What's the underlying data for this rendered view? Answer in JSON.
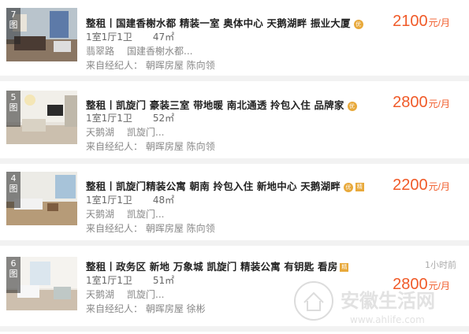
{
  "listings": [
    {
      "photo_count": "7",
      "photo_label": "图",
      "title": "整租丨国建香榭水都 精装一室 奥体中心 天鹅湖畔 振业大厦",
      "badge": "优",
      "layout": "1室1厅1卫",
      "area": "47㎡",
      "location": "翡翠路",
      "sublocation": "国建香榭水都...",
      "agent": "来自经纪人：  朝晖房屋 陈向领",
      "price": "2100",
      "price_unit": "元/月",
      "time": ""
    },
    {
      "photo_count": "5",
      "photo_label": "图",
      "title": "整租丨凯旋门 豪装三室 带地暖 南北通透 拎包入住 品牌家",
      "badge": "优",
      "layout": "1室1厅1卫",
      "area": "52㎡",
      "location": "天鹅湖",
      "sublocation": "凯旋门...",
      "agent": "来自经纪人：  朝晖房屋 陈向领",
      "price": "2800",
      "price_unit": "元/月",
      "time": ""
    },
    {
      "photo_count": "4",
      "photo_label": "图",
      "title": "整租丨凯旋门精装公寓 朝南 拎包入住 新地中心 天鹅湖畔",
      "badge": "优",
      "badge2": "精",
      "layout": "1室1厅1卫",
      "area": "48㎡",
      "location": "天鹅湖",
      "sublocation": "凯旋门...",
      "agent": "来自经纪人：  朝晖房屋 陈向领",
      "price": "2200",
      "price_unit": "元/月",
      "time": ""
    },
    {
      "photo_count": "6",
      "photo_label": "图",
      "title": "整租丨政务区 新地 万象城 凯旋门 精装公寓 有钥匙 看房",
      "badge2": "精",
      "layout": "1室1厅1卫",
      "area": "51㎡",
      "location": "天鹅湖",
      "sublocation": "凯旋门...",
      "agent": "来自经纪人：  朝晖房屋 徐彬",
      "price": "2800",
      "price_unit": "元/月",
      "time": "1小时前"
    }
  ],
  "watermark": {
    "text": "安徽生活网",
    "url": "www.ahlife.com"
  },
  "colors": {
    "price": "#f05a28",
    "badge": "#e8a93b",
    "separator": "#f2f2f2"
  }
}
